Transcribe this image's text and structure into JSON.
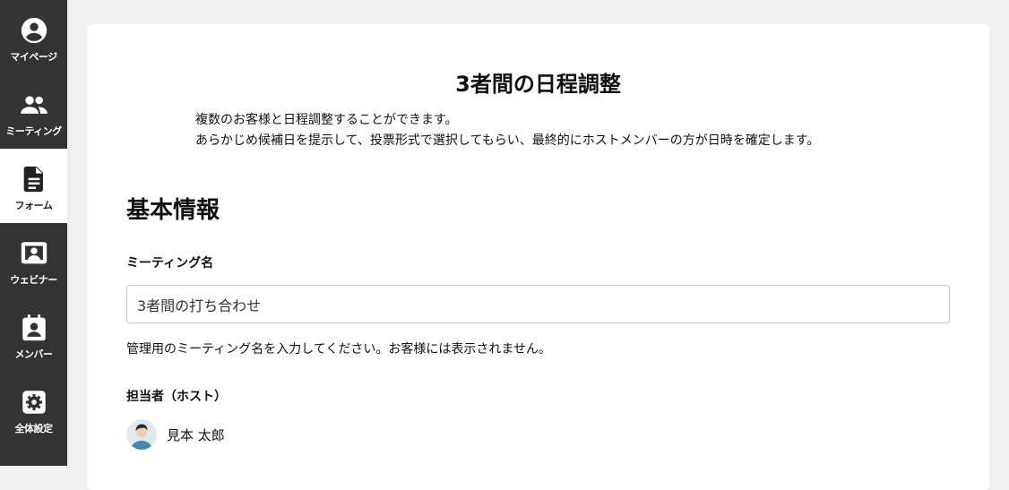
{
  "sidebar": {
    "items": [
      {
        "label": "マイページ",
        "icon": "account-circle-icon"
      },
      {
        "label": "ミーティング",
        "icon": "people-icon"
      },
      {
        "label": "フォーム",
        "icon": "document-icon",
        "active": true
      },
      {
        "label": "ウェビナー",
        "icon": "presentation-icon"
      },
      {
        "label": "メンバー",
        "icon": "member-badge-icon"
      },
      {
        "label": "全体設定",
        "icon": "gear-icon"
      }
    ]
  },
  "main": {
    "title": "3者間の日程調整",
    "intro_line1": "複数のお客様と日程調整することができます。",
    "intro_line2": "あらかじめ候補日を提示して、投票形式で選択してもらい、最終的にホストメンバーの方が日時を確定します。",
    "section_title": "基本情報",
    "meeting_name_label": "ミーティング名",
    "meeting_name_value": "3者間の打ち合わせ",
    "meeting_name_help": "管理用のミーティング名を入力してください。お客様には表示されません。",
    "host_label": "担当者（ホスト）",
    "host_name": "見本 太郎"
  },
  "colors": {
    "sidebar_bg": "#333333",
    "sidebar_active_bg": "#ffffff",
    "page_bg": "#f0f0f0",
    "card_bg": "#ffffff"
  }
}
